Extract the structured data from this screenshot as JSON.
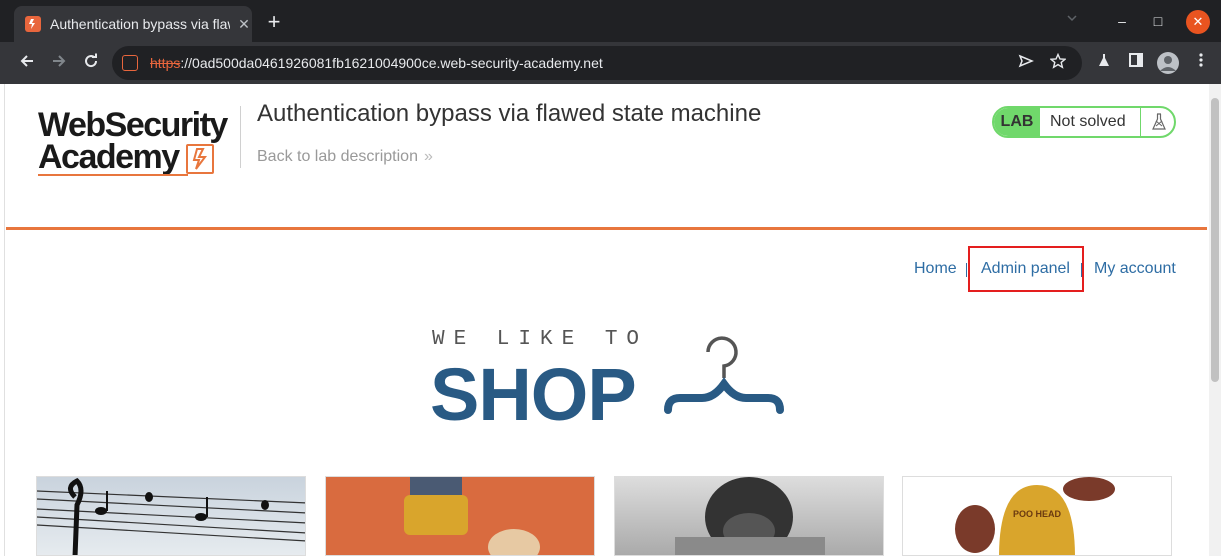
{
  "browser": {
    "tab_title": "Authentication bypass via flawed state machine",
    "tab_close": "✕",
    "new_tab": "+",
    "url_scheme": "https",
    "url_rest": "://0ad500da0461926081fb1621004900ce.web-security-academy.net",
    "icons": [
      "back-icon",
      "forward-icon",
      "reload-icon",
      "send-tab-icon",
      "bookmark-star-icon",
      "labs-icon",
      "side-panel-icon",
      "profile-icon",
      "menu-icon"
    ],
    "window_buttons": {
      "minimize": "–",
      "maximize": "□",
      "close": "✕"
    }
  },
  "header": {
    "logo_line1": "WebSecurity",
    "logo_line2": "Academy",
    "lab_title": "Authentication bypass via flawed state machine",
    "back_link": "Back to lab description",
    "back_chevron": "»",
    "lab_tag": "LAB",
    "lab_status": "Not solved",
    "accent_color": "#e8763d",
    "status_color": "#70d86b"
  },
  "nav": {
    "home": "Home",
    "admin_panel": "Admin panel",
    "my_account": "My account",
    "link_color": "#2e6da4",
    "highlight_color": "#e41e1e"
  },
  "shop": {
    "tagline": "WE LIKE TO",
    "word": "SHOP",
    "brand_color": "#295a84"
  },
  "products": [
    {
      "image": "music-birds-on-wires"
    },
    {
      "image": "orange-toy-figure"
    },
    {
      "image": "dog-in-sweater"
    },
    {
      "image": "poo-head-hat"
    }
  ]
}
